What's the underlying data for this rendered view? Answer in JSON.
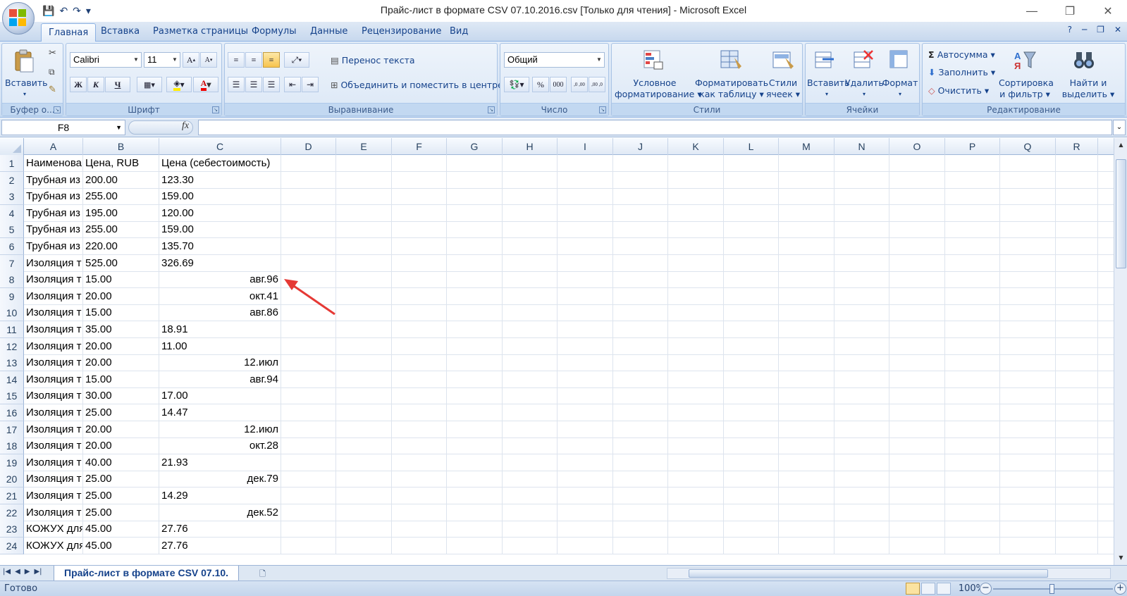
{
  "window": {
    "title": "Прайс-лист в формате CSV 07.10.2016.csv  [Только для чтения] - Microsoft Excel"
  },
  "qat": {
    "save": "💾",
    "undo": "↶",
    "redo": "↷",
    "more": "▾"
  },
  "tabs": [
    {
      "label": "Главная",
      "active": true
    },
    {
      "label": "Вставка"
    },
    {
      "label": "Разметка страницы"
    },
    {
      "label": "Формулы"
    },
    {
      "label": "Данные"
    },
    {
      "label": "Рецензирование"
    },
    {
      "label": "Вид"
    }
  ],
  "ribbon": {
    "clipboard": {
      "paste": "Вставить",
      "label": "Буфер о..."
    },
    "font": {
      "name": "Calibri",
      "size": "11",
      "bold": "Ж",
      "italic": "К",
      "underline": "Ч",
      "label": "Шрифт"
    },
    "alignment": {
      "wrap": "Перенос текста",
      "merge": "Объединить и поместить в центре",
      "label": "Выравнивание"
    },
    "number": {
      "format": "Общий",
      "percent": "%",
      "thousands": "000",
      "inc": ",0 ,00",
      "dec": ",00 ,0",
      "label": "Число"
    },
    "styles": {
      "conditional_1": "Условное",
      "conditional_2": "форматирование",
      "table_1": "Форматировать",
      "table_2": "как таблицу",
      "cell_1": "Стили",
      "cell_2": "ячеек",
      "label": "Стили"
    },
    "cells": {
      "insert": "Вставить",
      "delete": "Удалить",
      "format": "Формат",
      "label": "Ячейки"
    },
    "editing": {
      "autosum": "Автосумма",
      "fill": "Заполнить",
      "clear": "Очистить",
      "sort_1": "Сортировка",
      "sort_2": "и фильтр",
      "find_1": "Найти и",
      "find_2": "выделить",
      "label": "Редактирование"
    }
  },
  "formula_bar": {
    "name_box": "F8",
    "fx": "fx",
    "value": ""
  },
  "columns": [
    "A",
    "B",
    "C",
    "D",
    "E",
    "F",
    "G",
    "H",
    "I",
    "J",
    "K",
    "L",
    "M",
    "N",
    "O",
    "P",
    "Q",
    "R"
  ],
  "rows": [
    {
      "n": "1",
      "a": "Наименова",
      "b": "Цена, RUB",
      "c": "Цена (себестоимость)",
      "c_right": false
    },
    {
      "n": "2",
      "a": "Трубная из",
      "b": "200.00",
      "c": "123.30",
      "c_right": false
    },
    {
      "n": "3",
      "a": "Трубная из",
      "b": "255.00",
      "c": "159.00",
      "c_right": false
    },
    {
      "n": "4",
      "a": "Трубная из",
      "b": "195.00",
      "c": "120.00",
      "c_right": false
    },
    {
      "n": "5",
      "a": "Трубная из",
      "b": "255.00",
      "c": "159.00",
      "c_right": false
    },
    {
      "n": "6",
      "a": "Трубная из",
      "b": "220.00",
      "c": "135.70",
      "c_right": false
    },
    {
      "n": "7",
      "a": "Изоляция т",
      "b": "525.00",
      "c": "326.69",
      "c_right": false
    },
    {
      "n": "8",
      "a": "Изоляция т",
      "b": "15.00",
      "c": "авг.96",
      "c_right": true
    },
    {
      "n": "9",
      "a": "Изоляция т",
      "b": "20.00",
      "c": "окт.41",
      "c_right": true
    },
    {
      "n": "10",
      "a": "Изоляция т",
      "b": "15.00",
      "c": "авг.86",
      "c_right": true
    },
    {
      "n": "11",
      "a": "Изоляция т",
      "b": "35.00",
      "c": "18.91",
      "c_right": false
    },
    {
      "n": "12",
      "a": "Изоляция т",
      "b": "20.00",
      "c": "11.00",
      "c_right": false
    },
    {
      "n": "13",
      "a": "Изоляция т",
      "b": "20.00",
      "c": "12.июл",
      "c_right": true
    },
    {
      "n": "14",
      "a": "Изоляция т",
      "b": "15.00",
      "c": "авг.94",
      "c_right": true
    },
    {
      "n": "15",
      "a": "Изоляция т",
      "b": "30.00",
      "c": "17.00",
      "c_right": false
    },
    {
      "n": "16",
      "a": "Изоляция т",
      "b": "25.00",
      "c": "14.47",
      "c_right": false
    },
    {
      "n": "17",
      "a": "Изоляция т",
      "b": "20.00",
      "c": "12.июл",
      "c_right": true
    },
    {
      "n": "18",
      "a": "Изоляция т",
      "b": "20.00",
      "c": "окт.28",
      "c_right": true
    },
    {
      "n": "19",
      "a": "Изоляция т",
      "b": "40.00",
      "c": "21.93",
      "c_right": false
    },
    {
      "n": "20",
      "a": "Изоляция т",
      "b": "25.00",
      "c": "дек.79",
      "c_right": true
    },
    {
      "n": "21",
      "a": "Изоляция т",
      "b": "25.00",
      "c": "14.29",
      "c_right": false
    },
    {
      "n": "22",
      "a": "Изоляция т",
      "b": "25.00",
      "c": "дек.52",
      "c_right": true
    },
    {
      "n": "23",
      "a": "КОЖУХ для",
      "b": "45.00",
      "c": "27.76",
      "c_right": false
    },
    {
      "n": "24",
      "a": "КОЖУХ для",
      "b": "45.00",
      "c": "27.76",
      "c_right": false
    }
  ],
  "sheet_tab": "Прайс-лист в формате CSV 07.10.",
  "status": {
    "text": "Готово",
    "zoom": "100%"
  },
  "colors": {
    "annotation_arrow": "#e53935",
    "accent": "#15428b"
  }
}
